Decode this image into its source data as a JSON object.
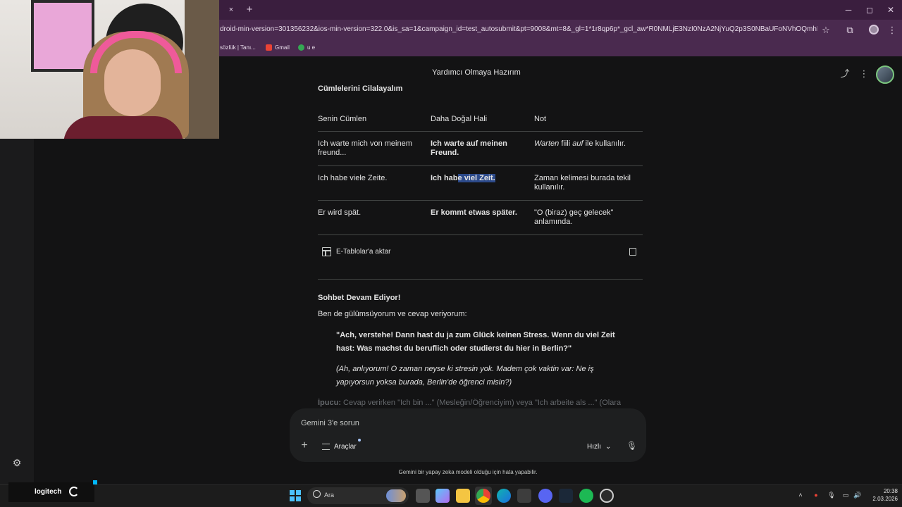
{
  "browser": {
    "tab_close": "×",
    "tab_new": "+",
    "url": "droid-min-version=301356232&ios-min-version=322.0&is_sa=1&campaign_id=test_autosubmit&pt=9008&mt=8&_gl=1*1r8qp6p*_gcl_aw*R0NMLjE3NzI0NzA2NjYuQ2p3S0NBaUFoNVhOQmhBQUVpd0F...",
    "bookmarks": [
      "sözlük | Tanı...",
      "Gmail",
      "u e"
    ],
    "window": {
      "minimize": "─",
      "maximize": "◻",
      "close": "✕"
    }
  },
  "header": {
    "chat_title": "Yardımcı Olmaya Hazırım"
  },
  "response": {
    "table_heading": "Cümlelerini Cilalayalım",
    "columns": [
      "Senin Cümlen",
      "Daha Doğal Hali",
      "Not"
    ],
    "rows": [
      {
        "original": "Ich warte mich von meinem freund...",
        "natural": "Ich warte auf meinen Freund.",
        "note_italic": "Warten",
        "note_mid": " fiili ",
        "note_italic2": "auf",
        "note_tail": " ile kullanılır."
      },
      {
        "original": "Ich habe viele Zeite.",
        "natural_pre": "Ich hab",
        "natural_hl": "e viel Zeit.",
        "note": "Zaman kelimesi burada tekil kullanılır."
      },
      {
        "original": "Er wird spät.",
        "natural": "Er kommt etwas später.",
        "note": "\"O (biraz) geç gelecek\" anlamında."
      }
    ],
    "export_label": "E-Tablolar'a aktar",
    "chat_heading": "Sohbet Devam Ediyor!",
    "chat_intro": "Ben de gülümsüyorum ve cevap veriyorum:",
    "quote_de": "\"Ach, verstehe! Dann hast du ja zum Glück keinen Stress. Wenn du viel Zeit hast: Was machst du beruflich oder studierst du hier in Berlin?\"",
    "quote_tr": "(Ah, anlıyorum! O zaman neyse ki stresin yok. Madem çok vaktin var: Ne iş yapıyorsun yoksa burada, Berlin'de öğrenci misin?)",
    "tip_label": "İpucu:",
    "tip_text": " Cevap verirken \"Ich bin ...\" (Mesleğin/Öğrenciyim) veya \"Ich arbeite als ...\" (Olarak"
  },
  "input": {
    "placeholder": "Gemini 3'e sorun",
    "tools_label": "Araçlar",
    "speed_label": "Hızlı"
  },
  "disclaimer": "Gemini bir yapay zeka modeli olduğu için hata yapabilir.",
  "taskbar": {
    "logitech_label": "logitech",
    "search_label": "Ara",
    "time": "20:38",
    "date": "2.03.2026"
  },
  "icons": {
    "share": "share-icon",
    "more": "more-vert-icon",
    "mic": "mic-icon",
    "plus": "plus-icon",
    "settings": "gear-icon"
  },
  "colors": {
    "background": "#131314",
    "tabbar": "#3a1e3e",
    "toolbar": "#4a2a4f",
    "highlight": "#2c4a8a",
    "input": "#1e1f20"
  }
}
